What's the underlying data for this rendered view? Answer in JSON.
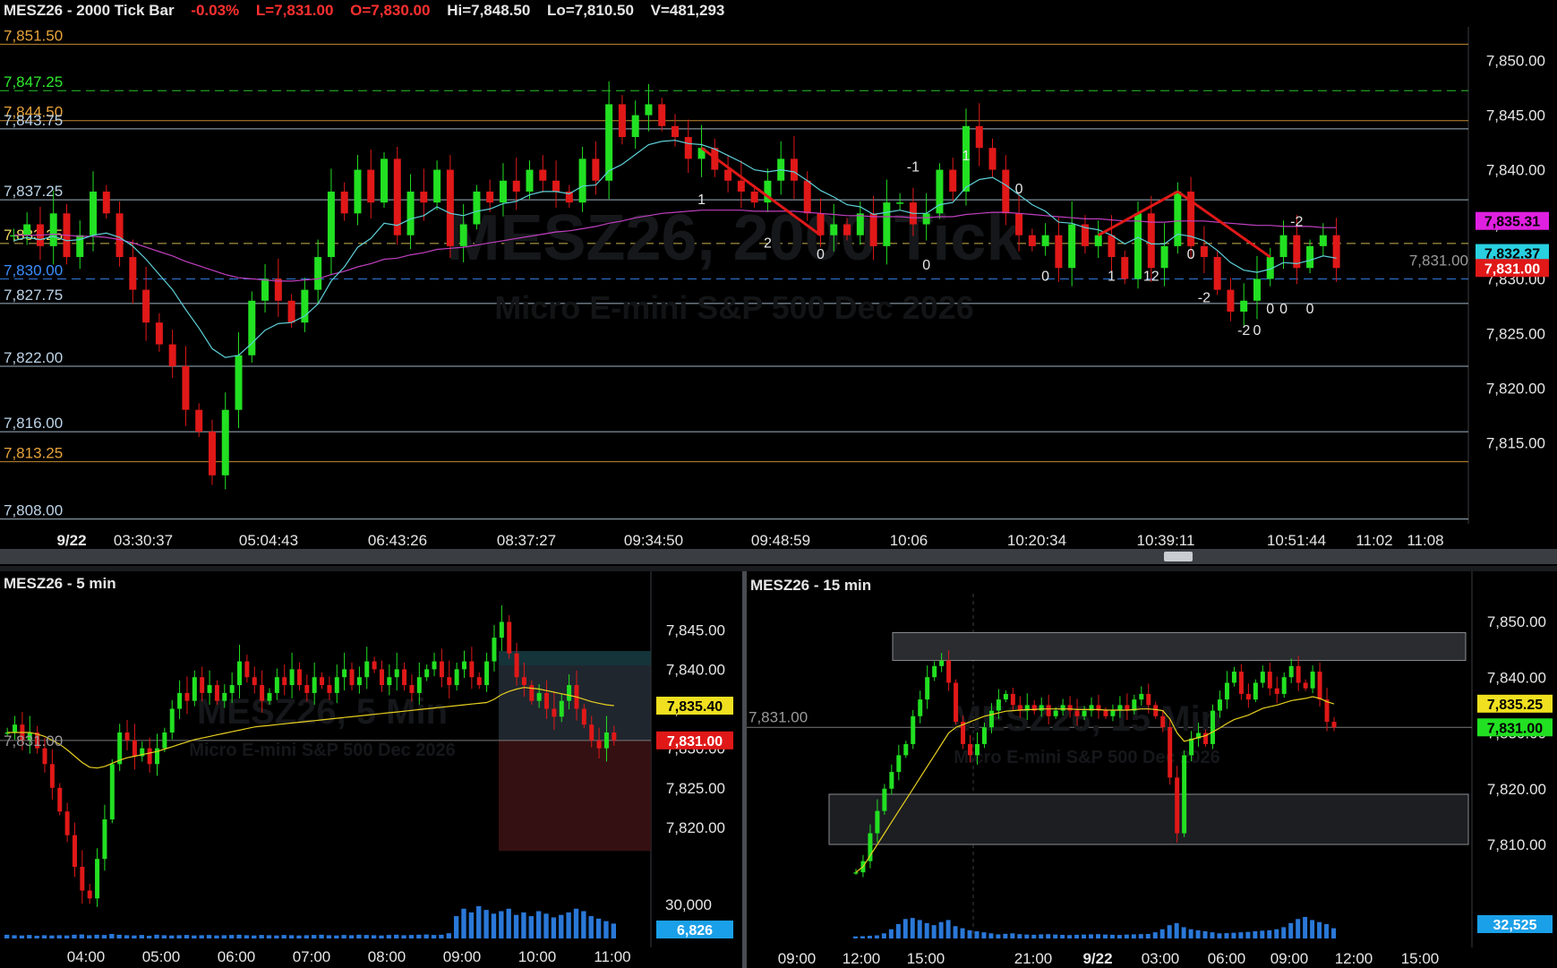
{
  "main": {
    "header": {
      "symbol": "MESZ26 - 2000 Tick Bar",
      "change": "-0.03%",
      "last": "L=7,831.00",
      "open": "O=7,830.00",
      "high": "Hi=7,848.50",
      "low": "Lo=7,810.50",
      "volume": "V=481,293"
    },
    "watermark": "MESZ26, 2000 Tick",
    "subwatermark": "Micro E-mini S&P 500 Dec 2026",
    "y_ticks": [
      "7,850.00",
      "7,845.00",
      "7,840.00",
      "7,835.00",
      "7,830.00",
      "7,825.00",
      "7,820.00",
      "7,815.00"
    ],
    "x_labels": [
      "9/22",
      "03:30:37",
      "05:04:43",
      "06:43:26",
      "08:37:27",
      "09:34:50",
      "09:48:59",
      "10:06",
      "10:20:34",
      "10:39:11",
      "10:51:44",
      "11:02",
      "11:08"
    ],
    "levels": [
      {
        "label": "7,851.50",
        "price": 7851.5,
        "color": "#e8a33a",
        "dash": false
      },
      {
        "label": "7,847.25",
        "price": 7847.25,
        "color": "#2ee82e",
        "dash": true
      },
      {
        "label": "7,844.50",
        "price": 7844.5,
        "color": "#e8a33a",
        "dash": false
      },
      {
        "label": "7,843.75",
        "price": 7843.75,
        "color": "#bcd4e8",
        "dash": false
      },
      {
        "label": "7,837.25",
        "price": 7837.25,
        "color": "#bcd4e8",
        "dash": false
      },
      {
        "label": "7,833.25",
        "price": 7833.25,
        "color": "#f0d860",
        "dash": true
      },
      {
        "label": "7,830.00",
        "price": 7830.0,
        "color": "#3b8fff",
        "dash": true
      },
      {
        "label": "7,827.75",
        "price": 7827.75,
        "color": "#bcd4e8",
        "dash": false
      },
      {
        "label": "7,822.00",
        "price": 7822.0,
        "color": "#bcd4e8",
        "dash": false
      },
      {
        "label": "7,816.00",
        "price": 7816.0,
        "color": "#bcd4e8",
        "dash": false
      },
      {
        "label": "7,813.25",
        "price": 7813.25,
        "color": "#e8a33a",
        "dash": false
      },
      {
        "label": "7,808.00",
        "price": 7808.0,
        "color": "#bcd4e8",
        "dash": false
      }
    ],
    "price_tags": [
      {
        "label": "7,835.31",
        "price": 7835.31,
        "bg": "#e020e0",
        "fg": "#000"
      },
      {
        "label": "7,832.37",
        "price": 7832.37,
        "bg": "#28d0e0",
        "fg": "#000"
      },
      {
        "label": "7,831.00",
        "price": 7831.0,
        "bg": "#e01818",
        "fg": "#fff"
      }
    ],
    "last_price_text": "7,831.00",
    "marker_labels": [
      "1",
      "2",
      "0",
      "-1",
      "0",
      "1",
      "0",
      "0",
      "1",
      "12",
      "0",
      "-2",
      "-2",
      "0",
      "0",
      "0",
      "-2",
      "0"
    ]
  },
  "chart_data": [
    {
      "type": "candlestick",
      "title": "MESZ26 - 2000 Tick Bar",
      "ylim": [
        7808,
        7852
      ],
      "closes": [
        7834,
        7835,
        7833,
        7836,
        7832,
        7834,
        7838,
        7836,
        7832,
        7829,
        7826,
        7824,
        7822,
        7818,
        7816,
        7812,
        7818,
        7823,
        7828,
        7830,
        7828,
        7826,
        7829,
        7832,
        7838,
        7836,
        7840,
        7837,
        7841,
        7834,
        7838,
        7837,
        7840,
        7833,
        7835,
        7838,
        7837,
        7839,
        7838,
        7840,
        7839,
        7838,
        7837,
        7841,
        7839,
        7846,
        7843,
        7845,
        7846,
        7844,
        7843,
        7841,
        7842,
        7840,
        7839,
        7838,
        7837,
        7839,
        7841,
        7839,
        7836,
        7834,
        7835,
        7834,
        7836,
        7833,
        7837,
        7837,
        7835,
        7836,
        7840,
        7838,
        7844,
        7842,
        7840,
        7836,
        7834,
        7833,
        7834,
        7831,
        7835,
        7833,
        7834,
        7832,
        7830,
        7836,
        7831,
        7833,
        7838,
        7833,
        7832,
        7829,
        7827,
        7828,
        7830,
        7832,
        7834,
        7831,
        7833,
        7834,
        7831
      ],
      "ema_fast": [
        7833.5,
        7833.8,
        7833.6,
        7833.9,
        7833.5,
        7833.6,
        7834.0,
        7834.2,
        7833.8,
        7833.0,
        7831.8,
        7830.4,
        7829.0,
        7827.2,
        7825.5,
        7823.6,
        7822.8,
        7823.0,
        7824.1,
        7825.3,
        7825.9,
        7826.0,
        7826.6,
        7827.7,
        7829.8,
        7831.1,
        7832.9,
        7833.7,
        7835.1,
        7834.9,
        7835.5,
        7835.8,
        7836.6,
        7836.0,
        7835.8,
        7836.2,
        7836.4,
        7836.9,
        7837.1,
        7837.7,
        7838.0,
        7838.0,
        7837.8,
        7838.5,
        7838.6,
        7839.9,
        7840.5,
        7841.4,
        7842.3,
        7842.6,
        7842.7,
        7842.4,
        7842.3,
        7841.9,
        7841.3,
        7840.7,
        7840.0,
        7839.8,
        7840.0,
        7839.8,
        7839.0,
        7838.1,
        7837.5,
        7836.8,
        7836.6,
        7835.9,
        7836.1,
        7836.3,
        7836.0,
        7836.0,
        7836.8,
        7837.0,
        7838.4,
        7839.1,
        7839.3,
        7838.6,
        7837.7,
        7836.8,
        7836.2,
        7835.2,
        7835.1,
        7834.7,
        7834.5,
        7834.0,
        7833.2,
        7833.8,
        7833.2,
        7833.2,
        7834.1,
        7833.9,
        7833.5,
        7832.6,
        7831.5,
        7830.8,
        7830.6,
        7830.9,
        7831.5,
        7831.4,
        7831.7,
        7832.1,
        7831.9
      ],
      "ema_slow": [
        7834,
        7834,
        7834,
        7834.1,
        7834,
        7833.9,
        7833.9,
        7833.8,
        7833.6,
        7833.3,
        7832.9,
        7832.5,
        7832.1,
        7831.6,
        7831.2,
        7830.8,
        7830.4,
        7830.1,
        7830.0,
        7829.9,
        7829.8,
        7829.8,
        7829.9,
        7830.0,
        7830.4,
        7830.7,
        7831.1,
        7831.4,
        7831.8,
        7831.9,
        7832.2,
        7832.4,
        7832.7,
        7832.8,
        7832.9,
        7833.1,
        7833.3,
        7833.5,
        7833.7,
        7833.9,
        7834.1,
        7834.3,
        7834.4,
        7834.6,
        7834.8,
        7835.1,
        7835.3,
        7835.6,
        7835.8,
        7836.0,
        7836.1,
        7836.2,
        7836.3,
        7836.3,
        7836.3,
        7836.3,
        7836.2,
        7836.2,
        7836.2,
        7836.2,
        7836.1,
        7836.0,
        7835.9,
        7835.8,
        7835.8,
        7835.7,
        7835.7,
        7835.7,
        7835.6,
        7835.6,
        7835.7,
        7835.7,
        7835.9,
        7836.0,
        7836.1,
        7836.1,
        7836.0,
        7835.9,
        7835.8,
        7835.7,
        7835.6,
        7835.5,
        7835.5,
        7835.4,
        7835.3,
        7835.3,
        7835.2,
        7835.2,
        7835.3,
        7835.3,
        7835.3,
        7835.2,
        7835.1,
        7835.0,
        7834.9,
        7834.9,
        7834.8,
        7834.8,
        7834.8,
        7834.7,
        7834.7
      ]
    },
    {
      "type": "candlestick",
      "title": "MESZ26 - 5 min",
      "ylim": [
        7814,
        7850
      ],
      "closes": [
        7832,
        7833,
        7831,
        7832,
        7830,
        7828,
        7825,
        7822,
        7819,
        7815,
        7812,
        7811,
        7816,
        7821,
        7828,
        7832,
        7831,
        7829,
        7830,
        7828,
        7830,
        7832,
        7835,
        7837,
        7836,
        7839,
        7837,
        7838,
        7836,
        7837,
        7838,
        7841,
        7839,
        7838,
        7836,
        7837,
        7839,
        7838,
        7840,
        7838,
        7837,
        7839,
        7838,
        7837,
        7839,
        7840,
        7838,
        7839,
        7841,
        7840,
        7838,
        7839,
        7840,
        7838,
        7837,
        7839,
        7840,
        7841,
        7839,
        7838,
        7840,
        7841,
        7839,
        7838,
        7841,
        7844,
        7846,
        7842,
        7839,
        7838,
        7836,
        7837,
        7835,
        7834,
        7836,
        7838,
        7835,
        7833,
        7831,
        7830,
        7832,
        7831
      ],
      "sma": [
        7832,
        7832,
        7832,
        7832,
        7831.8,
        7831.5,
        7831,
        7830.5,
        7829.8,
        7829,
        7828.2,
        7827.6,
        7827.5,
        7827.7,
        7828.1,
        7828.5,
        7828.8,
        7829,
        7829.2,
        7829.4,
        7829.6,
        7829.9,
        7830.2,
        7830.5,
        7830.8,
        7831.1,
        7831.3,
        7831.5,
        7831.7,
        7831.9,
        7832.1,
        7832.3,
        7832.5,
        7832.7,
        7832.8,
        7832.9,
        7833,
        7833.1,
        7833.2,
        7833.3,
        7833.4,
        7833.5,
        7833.6,
        7833.7,
        7833.8,
        7833.9,
        7834,
        7834.1,
        7834.2,
        7834.3,
        7834.4,
        7834.5,
        7834.6,
        7834.7,
        7834.8,
        7834.9,
        7835,
        7835.1,
        7835.2,
        7835.3,
        7835.4,
        7835.5,
        7835.6,
        7835.7,
        7835.8,
        7836.2,
        7836.8,
        7837.2,
        7837.5,
        7837.7,
        7837.6,
        7837.5,
        7837.3,
        7837.1,
        7836.9,
        7836.7,
        7836.5,
        7836.2,
        7835.9,
        7835.7,
        7835.5,
        7835.4
      ],
      "volume": [
        300,
        260,
        240,
        280,
        220,
        260,
        240,
        260,
        240,
        300,
        320,
        260,
        300,
        280,
        360,
        300,
        260,
        240,
        280,
        220,
        300,
        260,
        240,
        260,
        280,
        240,
        260,
        280,
        240,
        260,
        280,
        300,
        260,
        240,
        280,
        260,
        240,
        280,
        260,
        240,
        260,
        280,
        300,
        260,
        240,
        280,
        260,
        300,
        280,
        260,
        240,
        280,
        300,
        260,
        280,
        300,
        320,
        280,
        300,
        420,
        1800,
        2400,
        2100,
        2600,
        2300,
        2000,
        2200,
        2400,
        1900,
        2100,
        1800,
        2200,
        2000,
        1700,
        1900,
        2100,
        2400,
        2200,
        1800,
        1600,
        1400,
        1200
      ],
      "y_ticks": [
        "7,845.00",
        "7,840.00",
        "7,835.00",
        "7,830.00",
        "7,825.00",
        "7,820.00"
      ],
      "vol_tick": "30,000",
      "x_labels": [
        "04:00",
        "05:00",
        "06:00",
        "07:00",
        "08:00",
        "09:00",
        "10:00",
        "11:00"
      ],
      "sma_label": "7,835.40",
      "last_label": "7,831.00",
      "vol_label": "6,826",
      "last_text": "7,831.00",
      "watermark": "MESZ26, 5 Min",
      "subwatermark": "Micro E-mini S&P 500 Dec 2026"
    },
    {
      "type": "candlestick",
      "title": "MESZ26 - 15 min",
      "ylim": [
        7802,
        7854
      ],
      "closes": [
        7805,
        7807,
        7812,
        7816,
        7820,
        7823,
        7826,
        7828,
        7833,
        7836,
        7840,
        7842,
        7843,
        7839,
        7832,
        7828,
        7826,
        7828,
        7831,
        7834,
        7836,
        7837,
        7835,
        7834,
        7835,
        7834,
        7835,
        7833,
        7834,
        7835,
        7834,
        7833,
        7834,
        7835,
        7834,
        7833,
        7834,
        7835,
        7834,
        7836,
        7837,
        7835,
        7833,
        7831,
        7822,
        7812,
        7826,
        7829,
        7830,
        7828,
        7834,
        7836,
        7839,
        7841,
        7837,
        7836,
        7839,
        7841,
        7838,
        7837,
        7840,
        7842,
        7839,
        7838,
        7841,
        7836,
        7832,
        7831
      ],
      "sma": [
        7805,
        7806,
        7808,
        7810,
        7812,
        7814,
        7816,
        7818,
        7820,
        7822,
        7824,
        7826,
        7828,
        7830,
        7831,
        7831.5,
        7832,
        7832.5,
        7833,
        7833.3,
        7833.6,
        7833.9,
        7834,
        7834.1,
        7834.2,
        7834.2,
        7834.3,
        7834.3,
        7834.3,
        7834.3,
        7834.3,
        7834.2,
        7834.2,
        7834.2,
        7834.2,
        7834.1,
        7834.1,
        7834.1,
        7834.1,
        7834.2,
        7834.3,
        7834.3,
        7834.2,
        7834,
        7832.5,
        7830,
        7828.5,
        7828.8,
        7829.2,
        7829.5,
        7830.2,
        7830.9,
        7831.7,
        7832.4,
        7832.8,
        7833.2,
        7833.8,
        7834.4,
        7834.7,
        7835,
        7835.4,
        7835.8,
        7836,
        7836.2,
        7836.5,
        7836.2,
        7835.6,
        7835.2
      ],
      "volume": [
        200,
        220,
        260,
        300,
        500,
        900,
        1400,
        1900,
        2000,
        1800,
        1500,
        1300,
        1600,
        1800,
        1200,
        1000,
        800,
        700,
        600,
        500,
        400,
        450,
        500,
        420,
        380,
        360,
        400,
        420,
        380,
        350,
        330,
        360,
        380,
        400,
        420,
        380,
        360,
        340,
        380,
        400,
        420,
        440,
        600,
        900,
        1300,
        1500,
        1100,
        900,
        800,
        700,
        600,
        500,
        520,
        560,
        600,
        640,
        700,
        760,
        800,
        900,
        1100,
        1500,
        1900,
        2100,
        1800,
        1600,
        1400,
        1000
      ],
      "y_ticks": [
        "7,850.00",
        "7,840.00",
        "7,830.00",
        "7,820.00",
        "7,810.00"
      ],
      "x_labels": [
        "09:00",
        "12:00",
        "15:00",
        "21:00",
        "9/22",
        "03:00",
        "06:00",
        "09:00",
        "12:00",
        "15:00"
      ],
      "sma_label": "7,835.25",
      "last_label": "7,831.00",
      "vol_label": "32,525",
      "last_text": "7,831.00",
      "watermark": "MESZ26, 15 Min",
      "subwatermark": "Micro E-mini S&P 500 Dec 2026"
    }
  ],
  "colors": {
    "up": "#22e022",
    "down": "#e01818",
    "ema_fast": "#5ed0d8",
    "ema_slow": "#c040c0",
    "sma_yellow": "#e8d020",
    "volume": "#2a78d8",
    "grid": "#2a2d33",
    "axis_text": "#e6e6e6"
  }
}
